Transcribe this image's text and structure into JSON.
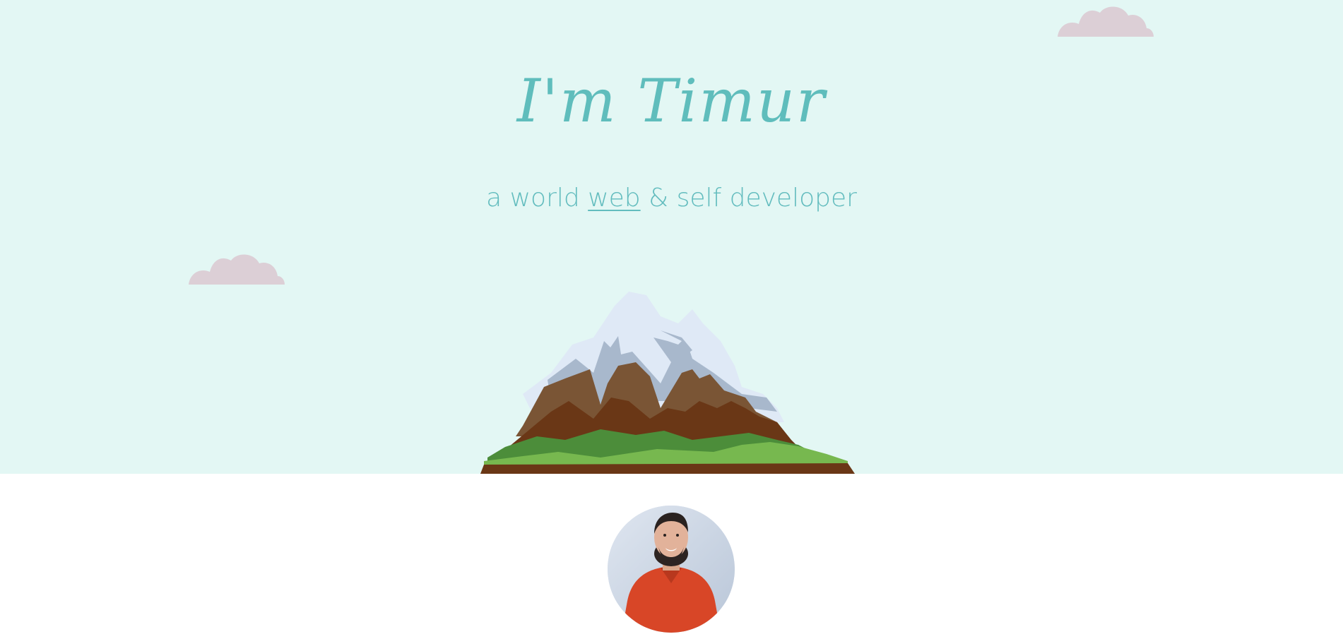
{
  "hero": {
    "title": "I'm Timur",
    "subtitle_prefix": "a world ",
    "subtitle_link": "web",
    "subtitle_suffix": " & self developer"
  },
  "colors": {
    "hero_background": "#e3f7f4",
    "accent": "#5fbdbc",
    "cloud": "#dccfd6",
    "page_background": "#ffffff"
  },
  "icons": {
    "cloud": "cloud-icon",
    "mountain": "mountain-illustration",
    "avatar": "profile-photo"
  }
}
